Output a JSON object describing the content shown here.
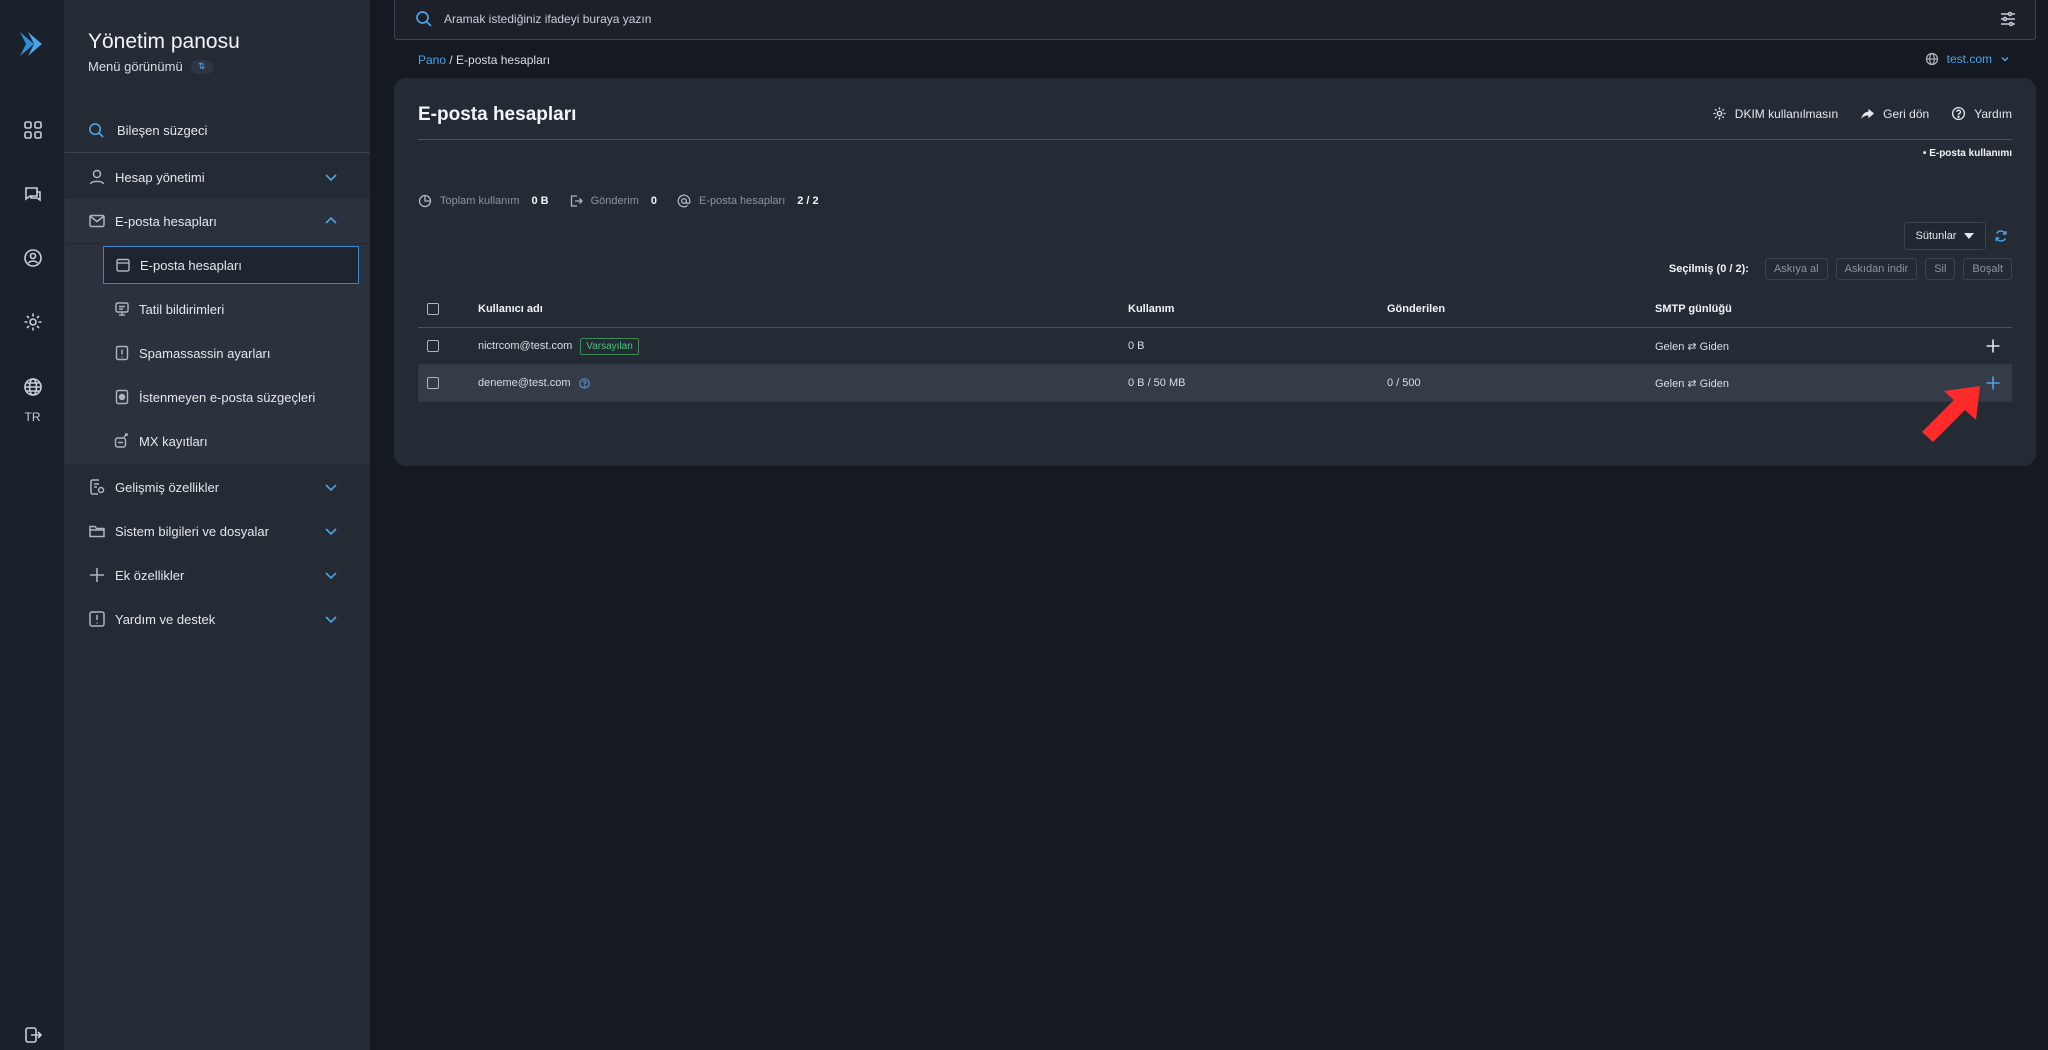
{
  "colors": {
    "accent": "#4ea3e6",
    "default_tag": "#4cc27a",
    "arrow": "#ff2a2a"
  },
  "rail": {
    "logo_icon": "panel-logo-icon",
    "icons": [
      "dashboard-icon",
      "chat-icon",
      "user-circle-icon",
      "gear-icon",
      "globe-icon",
      "logout-icon"
    ],
    "language": "TR"
  },
  "sidebar": {
    "title": "Yönetim panosu",
    "subtitle": "Menü görünümü",
    "filter_placeholder": "Bileşen süzgeci",
    "items": [
      {
        "label": "Hesap yönetimi",
        "icon": "user-icon"
      },
      {
        "label": "E-posta hesapları",
        "icon": "mail-icon",
        "expanded": true
      },
      {
        "label": "Gelişmiş özellikler",
        "icon": "advanced-icon"
      },
      {
        "label": "Sistem bilgileri ve dosyalar",
        "icon": "folder-icon"
      },
      {
        "label": "Ek özellikler",
        "icon": "plus-icon"
      },
      {
        "label": "Yardım ve destek",
        "icon": "alert-icon"
      }
    ],
    "email_subitems": [
      {
        "label": "E-posta hesapları",
        "icon": "calendar-icon",
        "active": true
      },
      {
        "label": "Tatil bildirimleri",
        "icon": "monitor-icon"
      },
      {
        "label": "Spamassassin ayarları",
        "icon": "alert-box-icon"
      },
      {
        "label": "İstenmeyen e-posta süzgeçleri",
        "icon": "filter-box-icon"
      },
      {
        "label": "MX kayıtları",
        "icon": "mx-icon"
      }
    ]
  },
  "topbar": {
    "search_placeholder": "Aramak istediğiniz ifadeyi buraya yazın"
  },
  "breadcrumb": {
    "home": "Pano",
    "separator": " / ",
    "current": "E-posta hesapları"
  },
  "domain_selector": {
    "value": "test.com"
  },
  "main": {
    "title": "E-posta hesapları",
    "actions": {
      "dkim": "DKIM kullanılmasın",
      "back": "Geri dön",
      "help": "Yardım"
    },
    "usage_link": "• E-posta kullanımı",
    "stats": {
      "total_label": "Toplam kullanım",
      "total_value": "0 B",
      "send_label": "Gönderim",
      "send_value": "0",
      "accounts_label": "E-posta hesapları",
      "accounts_value": "2 / 2"
    },
    "columns_button": "Sütunlar",
    "bulk": {
      "selected": "Seçilmiş (0 / 2):",
      "suspend": "Askıya al",
      "unsuspend": "Askıdan indir",
      "delete": "Sil",
      "empty": "Boşalt"
    },
    "table": {
      "headers": [
        "Kullanıcı adı",
        "Kullanım",
        "Gönderilen",
        "SMTP günlüğü"
      ],
      "rows": [
        {
          "user": "nictrcom@test.com",
          "tag": "Varsayılan",
          "usage": "0 B",
          "sent": "",
          "smtp": "Gelen ⇄ Giden"
        },
        {
          "user": "deneme@test.com",
          "tag": "",
          "usage": "0 B / 50 MB",
          "sent": "0 / 500",
          "smtp": "Gelen ⇄ Giden"
        }
      ]
    }
  }
}
